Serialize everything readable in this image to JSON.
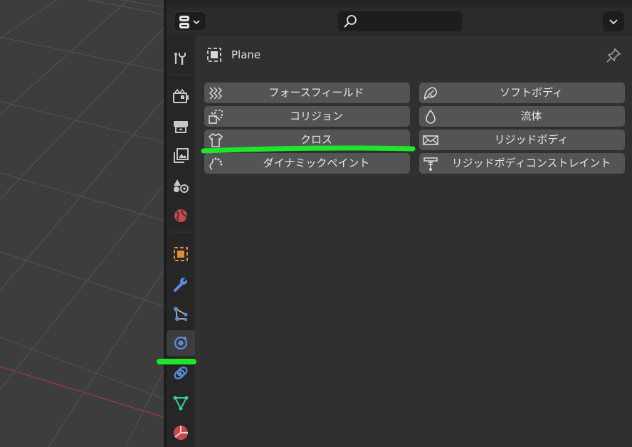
{
  "viewport": {
    "grid_color": "#555555",
    "axis_color": "#9a3a3a"
  },
  "header": {
    "search_placeholder": ""
  },
  "context": {
    "object_name": "Plane"
  },
  "sidebar": {
    "tabs": [
      {
        "icon": "tool-icon",
        "color": "#c8c8c8"
      },
      {
        "icon": "render-icon",
        "color": "#c8c8c8"
      },
      {
        "icon": "output-icon",
        "color": "#c8c8c8"
      },
      {
        "icon": "view-layer-icon",
        "color": "#c8c8c8"
      },
      {
        "icon": "scene-icon",
        "color": "#c8c8c8"
      },
      {
        "icon": "world-icon",
        "color": "#c74a4a"
      },
      {
        "icon": "object-icon",
        "color": "#e08a3c"
      },
      {
        "icon": "modifier-icon",
        "color": "#5d8ad6"
      },
      {
        "icon": "particles-icon",
        "color": "#5d8ad6"
      },
      {
        "icon": "physics-icon",
        "color": "#5d8ad6"
      },
      {
        "icon": "constraint-icon",
        "color": "#5d8ad6"
      },
      {
        "icon": "data-icon",
        "color": "#3ecf8e"
      },
      {
        "icon": "material-icon",
        "color": "#c74a4a"
      }
    ],
    "active_tab": "physics-icon"
  },
  "physics": {
    "buttons": [
      {
        "id": "force-field",
        "label": "フォースフィールド",
        "icon": "force-field-icon"
      },
      {
        "id": "soft-body",
        "label": "ソフトボディ",
        "icon": "soft-body-icon"
      },
      {
        "id": "collision",
        "label": "コリジョン",
        "icon": "collision-icon"
      },
      {
        "id": "fluid",
        "label": "流体",
        "icon": "fluid-icon"
      },
      {
        "id": "cloth",
        "label": "クロス",
        "icon": "cloth-icon"
      },
      {
        "id": "rigid-body",
        "label": "リジッドボディ",
        "icon": "rigid-body-icon"
      },
      {
        "id": "dynamic-paint",
        "label": "ダイナミックペイント",
        "icon": "dynamic-paint-icon"
      },
      {
        "id": "rigid-body-constraint",
        "label": "リジッドボディコンストレイント",
        "icon": "rigid-body-constraint-icon"
      }
    ]
  },
  "annotations": {
    "highlight_color": "#1fe62a"
  }
}
